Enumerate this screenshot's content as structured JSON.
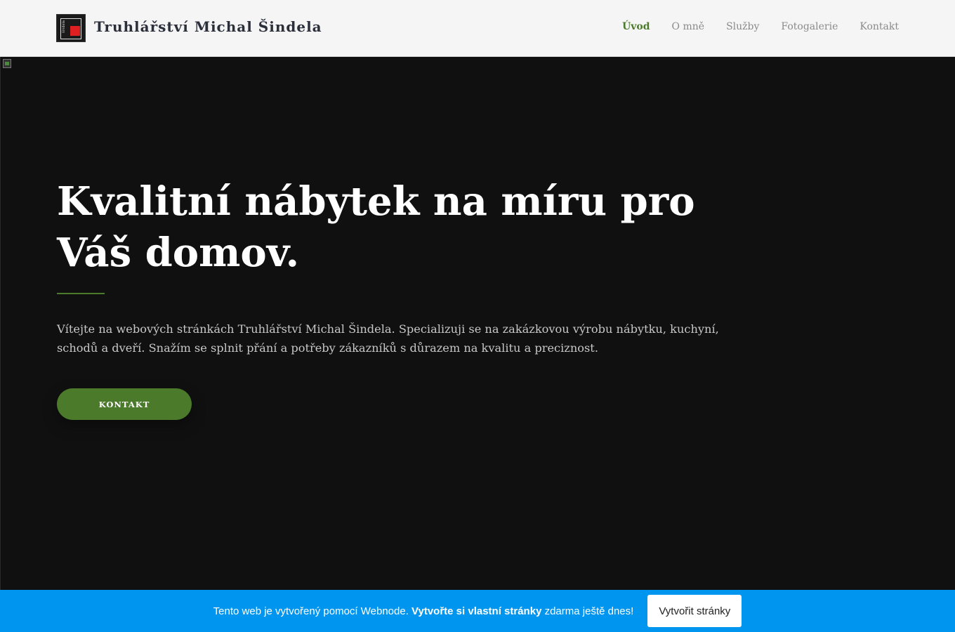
{
  "header": {
    "logo_text": "šindela",
    "site_title": "Truhlářství Michal Šindela",
    "nav": [
      {
        "label": "Úvod"
      },
      {
        "label": "O mně"
      },
      {
        "label": "Služby"
      },
      {
        "label": "Fotogalerie"
      },
      {
        "label": "Kontakt"
      }
    ]
  },
  "hero": {
    "headline": "Kvalitní nábytek na míru pro Váš domov.",
    "intro": "Vítejte na webových stránkách Truhlářství Michal Šindela. Specializuji se na zakázkovou výrobu nábytku, kuchyní, schodů a dveří. Snažím se splnit přání a potřeby zákazníků s důrazem na kvalitu a preciznost.",
    "cta_label": "KONTAKT"
  },
  "banner": {
    "text_before": "Tento web je vytvořený pomocí Webnode. ",
    "text_bold": "Vytvořte si vlastní stránky",
    "text_after": " zdarma ještě dnes!",
    "button_label": "Vytvořit stránky"
  },
  "colors": {
    "accent": "#4a7a2a",
    "banner": "#0096f0",
    "hero_bg": "#101010"
  }
}
